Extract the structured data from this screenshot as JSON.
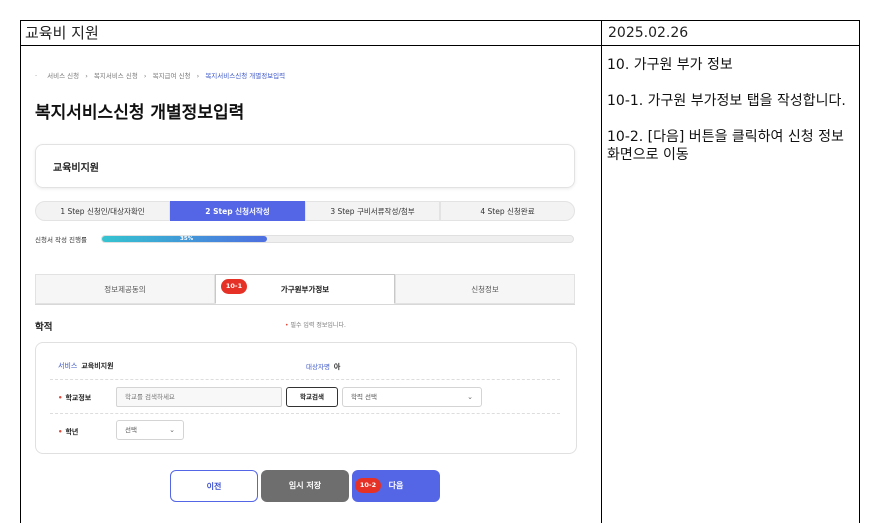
{
  "header": {
    "title": "교육비 지원",
    "date": "2025.02.26"
  },
  "notes": [
    "10. 가구원 부가 정보",
    "10-1. 가구원 부가정보 탭을 작성합니다.",
    "10-2. [다음] 버튼을 클릭하여 신청 정보 화면으로 이동"
  ],
  "breadcrumb": [
    "서비스 신청",
    "복지서비스 신청",
    "복지급여 신청",
    "복지서비스신청 개별정보입력"
  ],
  "page_title": "복지서비스신청 개별정보입력",
  "service_card": "교육비지원",
  "steps": [
    {
      "label": "1 Step 신청인/대상자확인",
      "active": false
    },
    {
      "label": "2 Step 신청서작성",
      "active": true
    },
    {
      "label": "3 Step 구비서류작성/첨부",
      "active": false
    },
    {
      "label": "4 Step 신청완료",
      "active": false
    }
  ],
  "progress": {
    "label": "신청서 작성 진행률",
    "value": 35,
    "text": "35%"
  },
  "tabs": [
    {
      "label": "정보제공동의",
      "active": false
    },
    {
      "label": "가구원부가정보",
      "active": true
    },
    {
      "label": "신청정보",
      "active": false
    }
  ],
  "markers": {
    "tab": "10-1",
    "next": "10-2"
  },
  "section": {
    "title": "학적",
    "required_note": "필수 입력 정보입니다.",
    "required_mark": "•"
  },
  "form": {
    "service_key": "서비스",
    "service_value": "교육비지원",
    "target_key": "대상자명",
    "target_value": "아",
    "school_label": "학교정보",
    "school_placeholder": "학교를 검색하세요",
    "school_search_button": "학교검색",
    "school_type_value": "학력 선택",
    "grade_label": "학년",
    "grade_value": "선택"
  },
  "buttons": {
    "prev": "이전",
    "save": "임시 저장",
    "next": "다음"
  },
  "colors": {
    "primary": "#5466e6",
    "marker": "#e63226",
    "progress_start": "#35c4d0"
  }
}
